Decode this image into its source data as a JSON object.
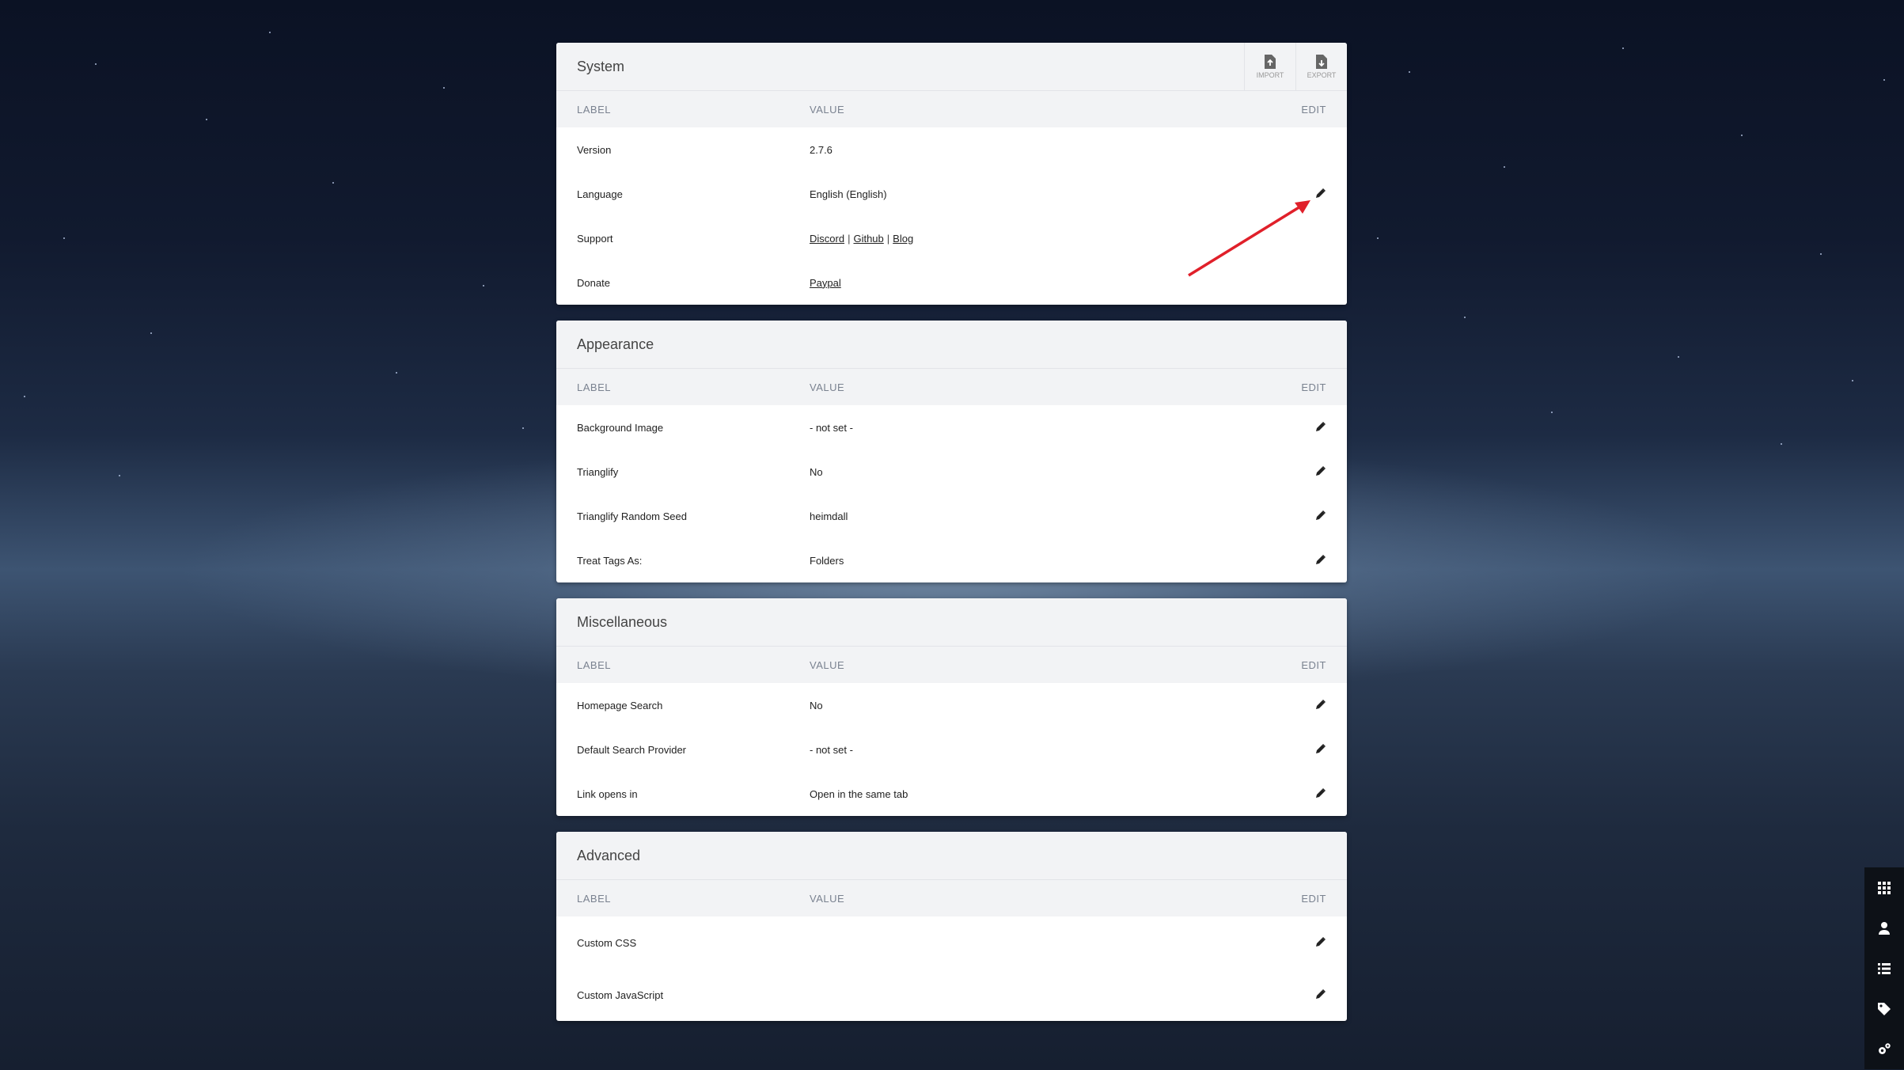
{
  "system": {
    "title": "System",
    "import_label": "IMPORT",
    "export_label": "EXPORT",
    "columns": {
      "label": "LABEL",
      "value": "VALUE",
      "edit": "EDIT"
    },
    "rows": {
      "version": {
        "label": "Version",
        "value": "2.7.6"
      },
      "language": {
        "label": "Language",
        "value": "English (English)"
      },
      "support": {
        "label": "Support",
        "links": [
          "Discord",
          "Github",
          "Blog"
        ],
        "separator": "|"
      },
      "donate": {
        "label": "Donate",
        "link": "Paypal"
      }
    }
  },
  "appearance": {
    "title": "Appearance",
    "columns": {
      "label": "LABEL",
      "value": "VALUE",
      "edit": "EDIT"
    },
    "rows": [
      {
        "label": "Background Image",
        "value": "- not set -"
      },
      {
        "label": "Trianglify",
        "value": "No"
      },
      {
        "label": "Trianglify Random Seed",
        "value": "heimdall"
      },
      {
        "label": "Treat Tags As:",
        "value": "Folders"
      }
    ]
  },
  "misc": {
    "title": "Miscellaneous",
    "columns": {
      "label": "LABEL",
      "value": "VALUE",
      "edit": "EDIT"
    },
    "rows": [
      {
        "label": "Homepage Search",
        "value": "No"
      },
      {
        "label": "Default Search Provider",
        "value": "- not set -"
      },
      {
        "label": "Link opens in",
        "value": "Open in the same tab"
      }
    ]
  },
  "advanced": {
    "title": "Advanced",
    "columns": {
      "label": "LABEL",
      "value": "VALUE",
      "edit": "EDIT"
    },
    "rows": [
      {
        "label": "Custom CSS",
        "value": ""
      },
      {
        "label": "Custom JavaScript",
        "value": ""
      }
    ]
  },
  "sidebar": {
    "items": [
      "grid-icon",
      "user-icon",
      "list-icon",
      "tag-icon",
      "cogs-icon"
    ]
  },
  "colors": {
    "annotation_arrow": "#e0202a",
    "sidebar_bg": "#0d1117"
  }
}
